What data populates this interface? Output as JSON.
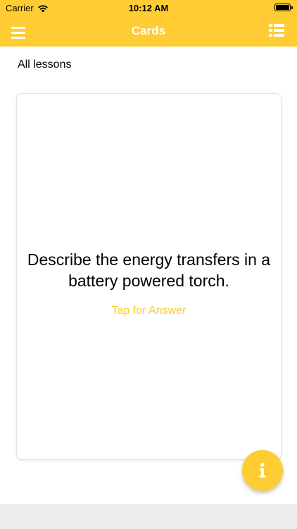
{
  "status_bar": {
    "carrier": "Carrier",
    "time": "10:12 AM",
    "battery_level": 1.0
  },
  "navbar": {
    "title": "Cards",
    "left_icon": "hamburger-menu-icon",
    "right_icon": "list-view-icon",
    "color": "#FFCC33"
  },
  "lessons": {
    "label": "All lessons"
  },
  "card": {
    "question": "Describe the energy transfers in a battery powered torch.",
    "tap_label": "Tap for Answer",
    "tap_color": "#F5CC33"
  },
  "fab": {
    "icon": "info-icon",
    "color": "#FFCC33"
  }
}
